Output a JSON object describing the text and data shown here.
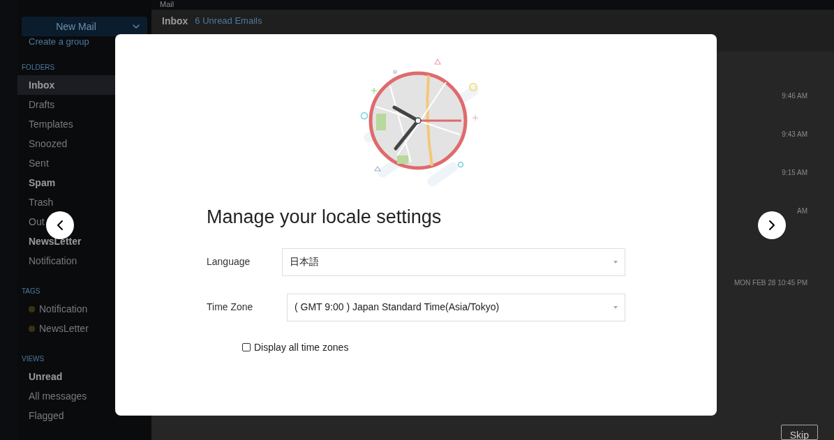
{
  "app": {
    "tab_title": "Mail",
    "new_mail": "New Mail",
    "create_group": "Create a group",
    "sections": [
      {
        "heading": "FOLDERS",
        "items": [
          {
            "label": "Inbox",
            "bold": true,
            "selected": true
          },
          {
            "label": "Drafts",
            "bold": false,
            "selected": false
          },
          {
            "label": "Templates",
            "bold": false,
            "selected": false
          },
          {
            "label": "Snoozed",
            "bold": false,
            "selected": false
          },
          {
            "label": "Sent",
            "bold": false,
            "selected": false
          },
          {
            "label": "Spam",
            "bold": true,
            "selected": false
          },
          {
            "label": "Trash",
            "bold": false,
            "selected": false
          },
          {
            "label": "Out",
            "bold": false,
            "selected": false
          },
          {
            "label": "NewsLetter",
            "bold": true,
            "selected": false
          },
          {
            "label": "Notification",
            "bold": false,
            "selected": false
          }
        ]
      },
      {
        "heading": "TAGS",
        "items": [
          {
            "label": "Notification",
            "bold": false,
            "selected": false,
            "color": "#3a3210"
          },
          {
            "label": "NewsLetter",
            "bold": false,
            "selected": false,
            "color": "#3a3210"
          }
        ]
      },
      {
        "heading": "VIEWS",
        "items": [
          {
            "label": "Unread",
            "bold": true,
            "selected": false
          },
          {
            "label": "All messages",
            "bold": false,
            "selected": false
          },
          {
            "label": "Flagged",
            "bold": false,
            "selected": false
          }
        ]
      }
    ],
    "folder_title": "Inbox",
    "unread_count": "6 Unread Emails",
    "rows": [
      {
        "time": "9:46 AM"
      },
      {
        "time": "9:43 AM"
      },
      {
        "time": "9:15 AM"
      },
      {
        "time": "AM"
      },
      {
        "time": "MON FEB 28 10:45 PM"
      }
    ],
    "skip": "Skip"
  },
  "dialog": {
    "title": "Manage your locale settings",
    "fields": [
      {
        "label": "Language",
        "value": "日本語"
      },
      {
        "label": "Time Zone",
        "value": "( GMT 9:00 ) Japan Standard Time(Asia/Tokyo)"
      }
    ],
    "checkbox": {
      "label": "Display all time zones",
      "checked": false
    }
  }
}
